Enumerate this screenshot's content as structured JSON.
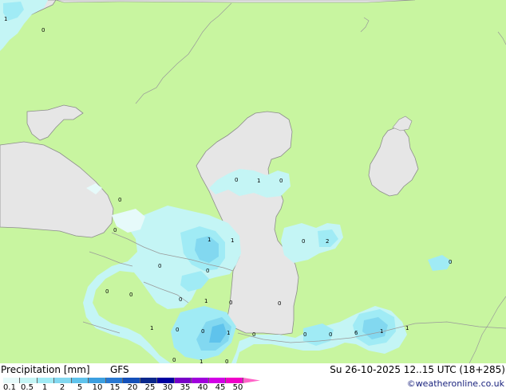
{
  "title": "Precipitation [mm]",
  "model": "GFS",
  "datetime": "Su 26-10-2025 12..15 UTC (18+285)",
  "credit": "©weatheronline.co.uk",
  "colors": {
    "land": "#c8f5a0",
    "sea": "#e6e6e6",
    "coast": "#8c8c8c",
    "border": "#999999"
  },
  "legend": {
    "colors": [
      "#e6fafa",
      "#c4f5f5",
      "#a0ebf5",
      "#82d8f0",
      "#5fc3ec",
      "#3c9fe0",
      "#2878d2",
      "#1450b9",
      "#0a288c",
      "#0000a0",
      "#7800c8",
      "#a000dc",
      "#d200e6",
      "#f000c8",
      "#ff64c8"
    ],
    "ticks": [
      "0.1",
      "0.5",
      "1",
      "2",
      "5",
      "10",
      "15",
      "20",
      "25",
      "30",
      "35",
      "40",
      "45",
      "50"
    ]
  },
  "value_labels": [
    {
      "id": "v1",
      "text": "1"
    },
    {
      "id": "v2",
      "text": "0"
    },
    {
      "id": "v3",
      "text": "0"
    },
    {
      "id": "v4",
      "text": "0"
    },
    {
      "id": "v5",
      "text": "1"
    },
    {
      "id": "v6",
      "text": "1"
    },
    {
      "id": "v7",
      "text": "0"
    },
    {
      "id": "v8",
      "text": "0"
    },
    {
      "id": "v9",
      "text": "0"
    },
    {
      "id": "v10",
      "text": "1"
    },
    {
      "id": "v11",
      "text": "0"
    },
    {
      "id": "v12",
      "text": "0"
    },
    {
      "id": "v13",
      "text": "2"
    },
    {
      "id": "v14",
      "text": "0"
    },
    {
      "id": "v15",
      "text": "0"
    },
    {
      "id": "v16",
      "text": "0"
    },
    {
      "id": "v17",
      "text": "0"
    },
    {
      "id": "v18",
      "text": "1"
    },
    {
      "id": "v19",
      "text": "0"
    },
    {
      "id": "v20",
      "text": "0"
    },
    {
      "id": "v21",
      "text": "1"
    },
    {
      "id": "v22",
      "text": "0"
    },
    {
      "id": "v23",
      "text": "0"
    },
    {
      "id": "v24",
      "text": "0"
    },
    {
      "id": "v25",
      "text": "1"
    },
    {
      "id": "v26",
      "text": "0"
    },
    {
      "id": "v27",
      "text": "0"
    },
    {
      "id": "v28",
      "text": "1"
    },
    {
      "id": "v29",
      "text": "6"
    },
    {
      "id": "v30",
      "text": "1"
    },
    {
      "id": "v31",
      "text": "0"
    },
    {
      "id": "v32",
      "text": "1"
    },
    {
      "id": "v33",
      "text": "0"
    }
  ]
}
